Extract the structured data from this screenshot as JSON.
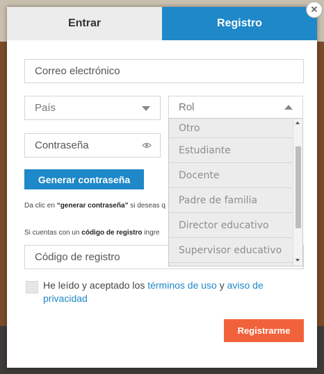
{
  "tabs": {
    "login": "Entrar",
    "register": "Registro"
  },
  "close_symbol": "✕",
  "form": {
    "email_placeholder": "Correo electrónico",
    "country_placeholder": "País",
    "role_placeholder": "Rol",
    "password_placeholder": "Contraseña",
    "generate_password_label": "Generar contraseña",
    "hint1": {
      "prefix": "Da clic en ",
      "bold": "“generar contraseña”",
      "suffix": " si deseas q"
    },
    "hint2": {
      "prefix": "Si cuentas con un ",
      "bold": "código de registro",
      "suffix": " ingre"
    },
    "registration_code_placeholder": "Código de registro",
    "terms": {
      "prefix": "He leído y aceptado los ",
      "terms_link": "términos de uso",
      "middle": " y ",
      "privacy_link": "aviso de privacidad"
    },
    "submit_label": "Registrarme"
  },
  "role_dropdown": {
    "options": [
      "Otro",
      "Estudiante",
      "Docente",
      "Padre de familia",
      "Director educativo",
      "Supervisor educativo"
    ]
  },
  "icons": {
    "close": "close-icon",
    "country_arrow": "chevron-down-icon",
    "role_arrow": "chevron-up-icon",
    "password_toggle": "eye-icon"
  },
  "colors": {
    "primary": "#1e88c8",
    "submit": "#f2623a",
    "tab_inactive": "#ececec"
  }
}
